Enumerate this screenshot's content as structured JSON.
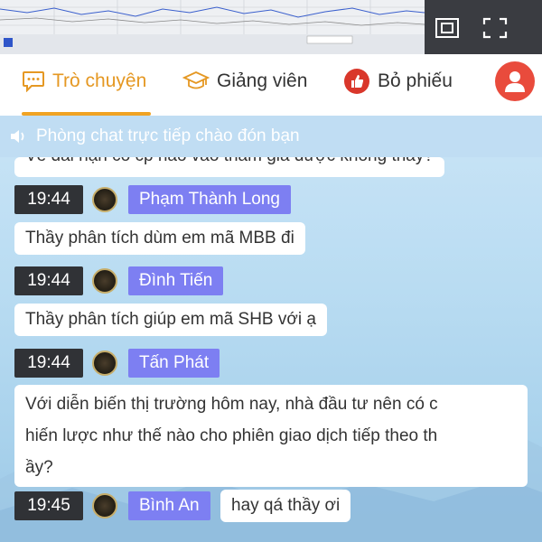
{
  "tabs": [
    {
      "label": "Trò chuyện",
      "icon": "chat-bubble-icon",
      "active": true
    },
    {
      "label": "Giảng viên",
      "icon": "graduation-cap-icon",
      "active": false
    },
    {
      "label": "Bỏ phiếu",
      "icon": "thumbs-up-icon",
      "active": false
    }
  ],
  "profile": {
    "icon": "user-icon"
  },
  "video": {
    "pip_icon": "picture-in-picture-icon",
    "fullscreen_icon": "fullscreen-icon"
  },
  "notice": {
    "text": "Phòng chat trực tiếp chào đón bạn",
    "icon": "speaker-icon"
  },
  "cutoff_message": "Về dài hạn có cp nào vào tham gia được không thầy?",
  "messages": [
    {
      "time": "19:44",
      "name": "Phạm Thành Long",
      "text": "Thầy phân tích dùm em mã MBB đi"
    },
    {
      "time": "19:44",
      "name": "Đình Tiến",
      "text": "Thầy phân tích giúp em mã SHB với ạ"
    },
    {
      "time": "19:44",
      "name": "Tấn Phát",
      "lines": [
        "Với diễn biến thị trường hôm nay, nhà đầu tư nên có c",
        "hiến lược như thế nào cho phiên giao dịch tiếp theo th",
        "ầy?"
      ]
    },
    {
      "time": "19:45",
      "name": "Bình An",
      "text": "hay qá thầy ơi"
    }
  ],
  "colors": {
    "accent": "#f0a323",
    "name_badge": "#7d7ff2",
    "time_badge": "#303236",
    "profile": "#e94b3c",
    "vote_icon": "#d9372b"
  }
}
